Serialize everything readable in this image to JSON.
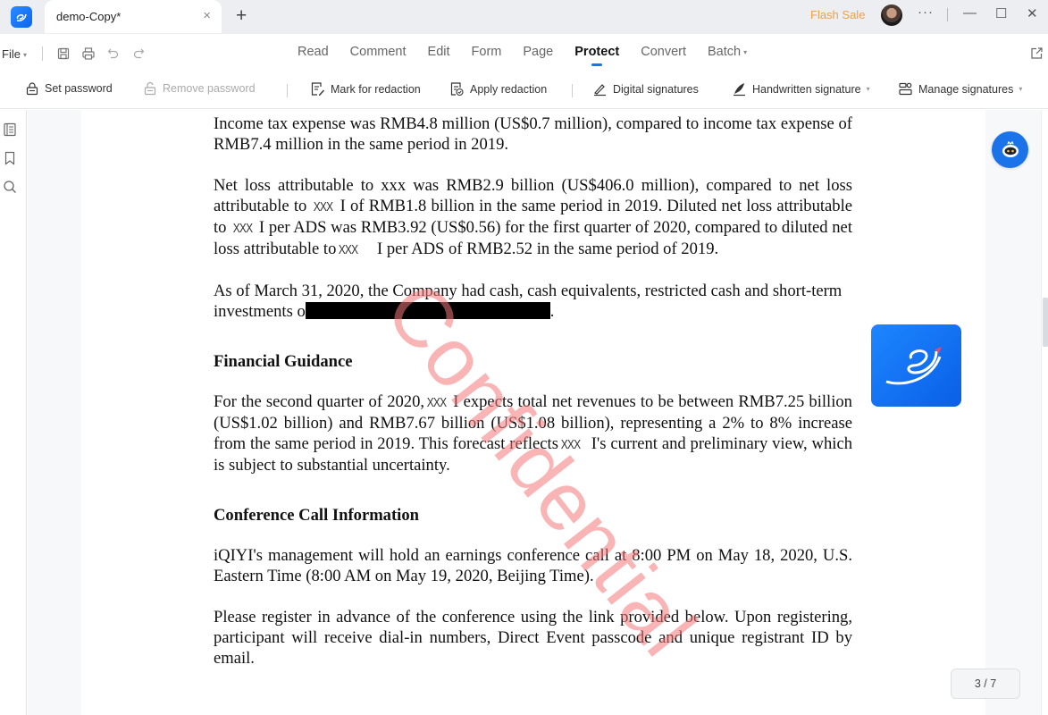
{
  "titlebar": {
    "tab_title": "demo-Copy*",
    "tab_close": "×",
    "new_tab": "+",
    "flash_sale": "Flash Sale",
    "more": "···",
    "minimize": "—",
    "maximize": "☐",
    "close": "✕"
  },
  "menubar": {
    "file_label": "File",
    "tabs": [
      {
        "label": "Read"
      },
      {
        "label": "Comment"
      },
      {
        "label": "Edit"
      },
      {
        "label": "Form"
      },
      {
        "label": "Page"
      },
      {
        "label": "Protect",
        "active": true
      },
      {
        "label": "Convert"
      },
      {
        "label": "Batch",
        "has_dropdown": true
      }
    ],
    "quick_icons": [
      "save-icon",
      "print-icon",
      "undo-icon",
      "redo-icon"
    ]
  },
  "toolbar": {
    "set_password": "Set password",
    "remove_password": "Remove password",
    "mark_for_redaction": "Mark for redaction",
    "apply_redaction": "Apply redaction",
    "digital_signatures": "Digital signatures",
    "handwritten_signature": "Handwritten signature",
    "manage_signatures": "Manage signatures"
  },
  "document": {
    "p1": "Income tax expense was RMB4.8 million (US$0.7 million), compared to income tax expense of RMB7.4 million in the same period in 2019.",
    "p2": {
      "a": "Net loss attributable to xxx was RMB2.9 billion (US$406.0 million), compared to net loss attributable to ",
      "x1": "XXX",
      "b": " I of RMB1.8 billion in the same period in 2019. Diluted net loss attributable to ",
      "x2": "XXX",
      "c": " I per ADS was RMB3.92 (US$0.56) for the first quarter of 2020, compared to diluted net loss attributable to",
      "x3": "XXX",
      "d": "    I per ADS of RMB2.52 in the same period of 2019."
    },
    "p3": {
      "a": "As of March 31, 2020, the Company had cash, cash equivalents, restricted cash and short-term investments o",
      "end": "."
    },
    "h1": "Financial Guidance",
    "p4": {
      "a": "For the second quarter of 2020,",
      "x1": "XXX",
      "b": " I expects total net revenues to be between RMB7.25 billion (US$1.02 billion) and RMB7.67 billion (US$1.08 billion), representing a 2% to 8% increase from the same period in 2019. This forecast reflects",
      "x2": "XXX",
      "c": "  I's current and preliminary view, which is subject to substantial uncertainty."
    },
    "h2": "Conference Call Information",
    "p5": "iQIYI's management will hold an earnings conference call at 8:00 PM on May 18, 2020, U.S. Eastern Time (8:00 AM on May 19, 2020, Beijing Time).",
    "p6": "Please register in advance of the conference using the link provided below. Upon registering, participant will receive dial-in numbers, Direct Event passcode and unique registrant ID by email.",
    "watermark": "Confidential"
  },
  "page_indicator": "3 / 7",
  "colors": {
    "accent": "#1a73e8",
    "flash_sale": "#f0a04b",
    "watermark": "#f47878",
    "redaction": "#000000"
  }
}
